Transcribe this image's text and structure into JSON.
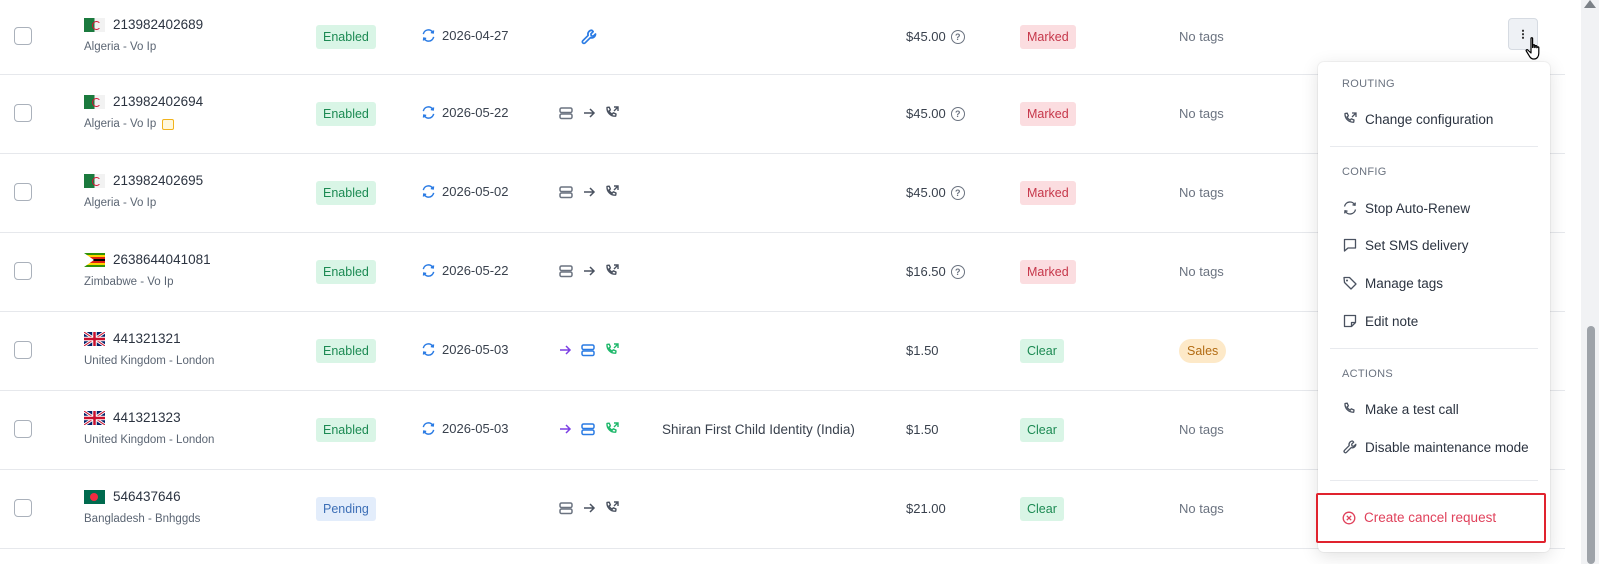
{
  "rows": [
    {
      "number": "213982402689",
      "location": "Algeria - Vo Ip",
      "status": "Enabled",
      "renew": "2026-04-27",
      "price": "$45.00",
      "compliance": "Marked",
      "tags": "No tags",
      "flag": "algeria",
      "route": "wrench"
    },
    {
      "number": "213982402694",
      "location": "Algeria - Vo Ip",
      "status": "Enabled",
      "renew": "2026-05-22",
      "price": "$45.00",
      "compliance": "Marked",
      "tags": "No tags",
      "flag": "algeria",
      "route": "server-phone",
      "note": true
    },
    {
      "number": "213982402695",
      "location": "Algeria - Vo Ip",
      "status": "Enabled",
      "renew": "2026-05-02",
      "price": "$45.00",
      "compliance": "Marked",
      "tags": "No tags",
      "flag": "algeria",
      "route": "server-phone"
    },
    {
      "number": "2638644041081",
      "location": "Zimbabwe - Vo Ip",
      "status": "Enabled",
      "renew": "2026-05-22",
      "price": "$16.50",
      "compliance": "Marked",
      "tags": "No tags",
      "flag": "zimbabwe",
      "route": "server-phone"
    },
    {
      "number": "441321321",
      "location": "United Kingdom - London",
      "status": "Enabled",
      "renew": "2026-05-03",
      "price": "$1.50",
      "compliance": "Clear",
      "tags": "Sales",
      "flag": "uk",
      "route": "active"
    },
    {
      "number": "441321323",
      "location": "United Kingdom - London",
      "status": "Enabled",
      "renew": "2026-05-03",
      "price": "$1.50",
      "compliance": "Clear",
      "tags": "No tags",
      "flag": "uk",
      "route": "active",
      "name": "Shiran First Child Identity (India)"
    },
    {
      "number": "546437646",
      "location": "Bangladesh - Bnhggds",
      "status": "Pending",
      "renew": "",
      "price": "$21.00",
      "compliance": "Clear",
      "tags": "No tags",
      "flag": "bangladesh",
      "route": "server-phone"
    }
  ],
  "menu": {
    "routing_header": "ROUTING",
    "change_configuration": "Change configuration",
    "config_header": "CONFIG",
    "stop_auto_renew": "Stop Auto-Renew",
    "set_sms_delivery": "Set SMS delivery",
    "manage_tags": "Manage tags",
    "edit_note": "Edit note",
    "actions_header": "ACTIONS",
    "make_test_call": "Make a test call",
    "disable_maintenance": "Disable maintenance mode",
    "create_cancel_request": "Create cancel request"
  },
  "colors": {
    "enabled_bg": "#d9f5e6",
    "marked_bg": "#fbdde0",
    "pending_bg": "#e3edfb",
    "accent_blue": "#2a7be4",
    "danger": "#e0232e"
  }
}
